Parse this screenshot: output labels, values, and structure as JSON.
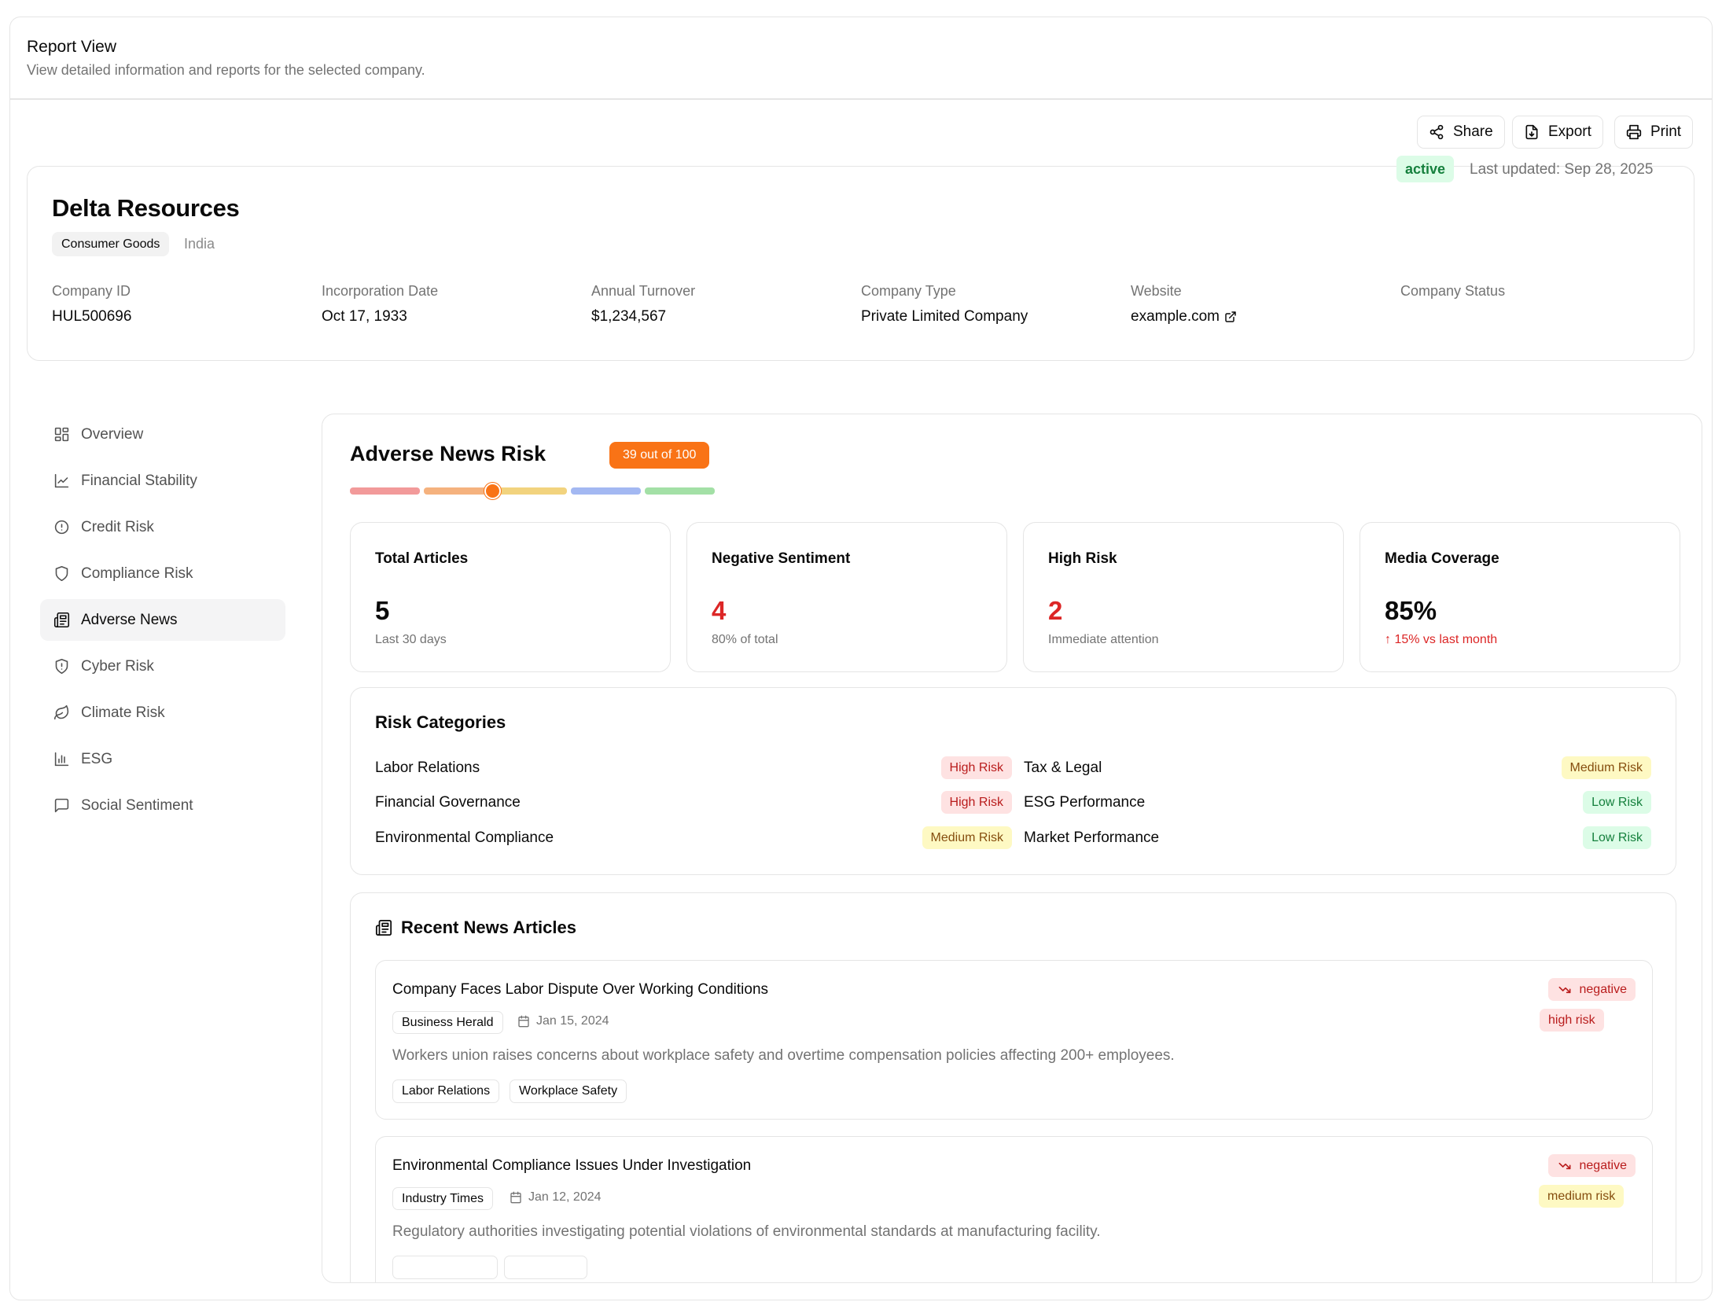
{
  "header": {
    "title": "Report View",
    "subtitle": "View detailed information and reports for the selected company."
  },
  "toolbar": {
    "share": "Share",
    "export": "Export",
    "print": "Print"
  },
  "company": {
    "name": "Delta Resources",
    "industry": "Consumer Goods",
    "country": "India",
    "fields": [
      {
        "label": "Company ID",
        "value": "HUL500696"
      },
      {
        "label": "Incorporation Date",
        "value": "Oct 17, 1933"
      },
      {
        "label": "Annual Turnover",
        "value": "$1,234,567"
      },
      {
        "label": "Company Type",
        "value": "Private Limited Company"
      },
      {
        "label": "Website",
        "value": "example.com"
      },
      {
        "label": "Company Status",
        "value": "active"
      }
    ],
    "last_updated": "Last updated: Sep 28, 2025"
  },
  "sidebar": {
    "items": [
      {
        "label": "Overview",
        "icon": "dashboard-icon"
      },
      {
        "label": "Financial Stability",
        "icon": "line-chart-icon"
      },
      {
        "label": "Credit Risk",
        "icon": "alert-circle-icon"
      },
      {
        "label": "Compliance Risk",
        "icon": "shield-icon"
      },
      {
        "label": "Adverse News",
        "icon": "newspaper-icon",
        "active": true
      },
      {
        "label": "Cyber Risk",
        "icon": "shield-alert-icon"
      },
      {
        "label": "Climate Risk",
        "icon": "leaf-icon"
      },
      {
        "label": "ESG",
        "icon": "bar-chart-icon"
      },
      {
        "label": "Social Sentiment",
        "icon": "message-square-icon"
      }
    ]
  },
  "adverse": {
    "title": "Adverse News Risk",
    "score_label": "39 out of 100",
    "score": 39,
    "scale_colors": [
      "#f29a9a",
      "#f5b27e",
      "#f2d37e",
      "#a3b8f2",
      "#a3e0a6"
    ],
    "stats": [
      {
        "label": "Total Articles",
        "value": "5",
        "sub": "Last 30 days",
        "emphasis": "normal"
      },
      {
        "label": "Negative Sentiment",
        "value": "4",
        "sub": "80% of total",
        "emphasis": "red"
      },
      {
        "label": "High Risk",
        "value": "2",
        "sub": "Immediate attention",
        "emphasis": "red"
      },
      {
        "label": "Media Coverage",
        "value": "85%",
        "sub": "↑ 15% vs last month",
        "emphasis": "trend"
      }
    ],
    "categories_title": "Risk Categories",
    "categories": [
      {
        "name": "Labor Relations",
        "level": "High Risk",
        "tone": "high"
      },
      {
        "name": "Tax & Legal",
        "level": "Medium Risk",
        "tone": "med"
      },
      {
        "name": "Financial Governance",
        "level": "High Risk",
        "tone": "high"
      },
      {
        "name": "ESG Performance",
        "level": "Low Risk",
        "tone": "low"
      },
      {
        "name": "Environmental Compliance",
        "level": "Medium Risk",
        "tone": "med"
      },
      {
        "name": "Market Performance",
        "level": "Low Risk",
        "tone": "low"
      }
    ],
    "news_title": "Recent News Articles",
    "articles": [
      {
        "title": "Company Faces Labor Dispute Over Working Conditions",
        "source": "Business Herald",
        "date": "Jan 15, 2024",
        "summary": "Workers union raises concerns about workplace safety and overtime compensation policies affecting 200+ employees.",
        "tags": [
          "Labor Relations",
          "Workplace Safety"
        ],
        "sentiment": "negative",
        "risk": "high risk"
      },
      {
        "title": "Environmental Compliance Issues Under Investigation",
        "source": "Industry Times",
        "date": "Jan 12, 2024",
        "summary": "Regulatory authorities investigating potential violations of environmental standards at manufacturing facility.",
        "tags": [],
        "sentiment": "negative",
        "risk": "medium risk"
      }
    ]
  }
}
